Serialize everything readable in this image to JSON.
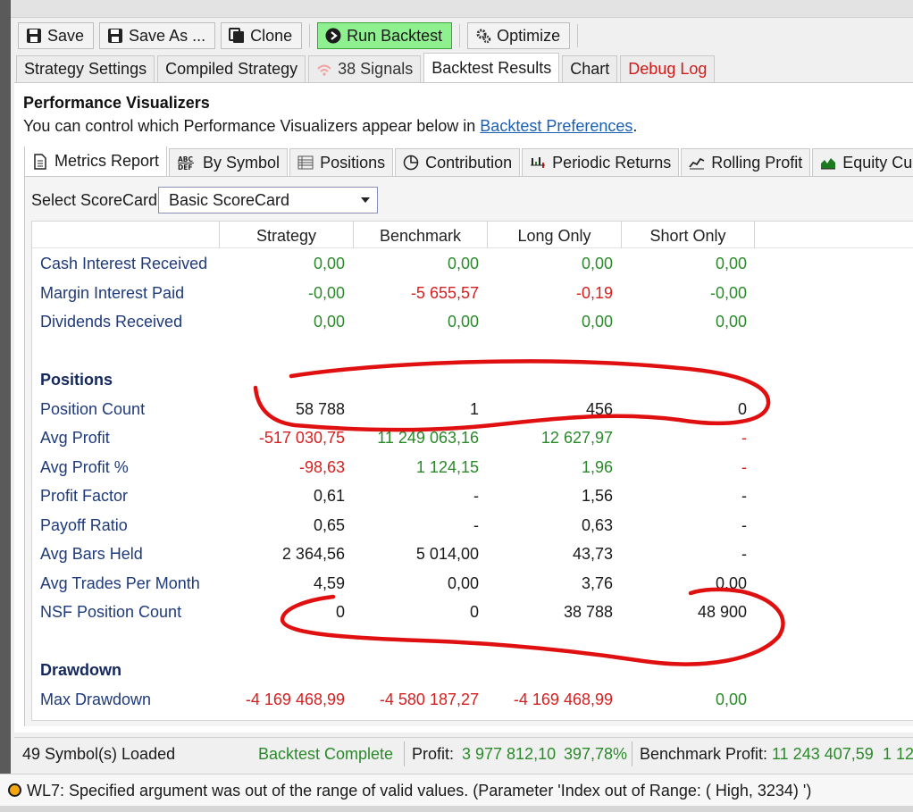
{
  "toolbar": {
    "save_label": "Save",
    "save_as_label": "Save As ...",
    "clone_label": "Clone",
    "run_backtest_label": "Run Backtest",
    "optimize_label": "Optimize"
  },
  "main_tabs": {
    "strategy_settings": "Strategy Settings",
    "compiled_strategy": "Compiled Strategy",
    "signals": "38 Signals",
    "backtest_results": "Backtest Results",
    "chart": "Chart",
    "debug_log": "Debug Log"
  },
  "visualizers": {
    "title": "Performance Visualizers",
    "desc_prefix": "You can control which Performance Visualizers appear below in ",
    "desc_link": "Backtest Preferences",
    "desc_suffix": "."
  },
  "viz_tabs": {
    "metrics_report": "Metrics Report",
    "by_symbol": "By Symbol",
    "positions": "Positions",
    "contribution": "Contribution",
    "periodic_returns": "Periodic Returns",
    "rolling_profit": "Rolling Profit",
    "equity_curve": "Equity Cu"
  },
  "scorecard": {
    "label": "Select ScoreCard:",
    "selected": "Basic ScoreCard"
  },
  "columns": [
    "Strategy",
    "Benchmark",
    "Long Only",
    "Short Only"
  ],
  "rows": [
    {
      "label": "Cash Interest Received",
      "values": [
        "0,00",
        "0,00",
        "0,00",
        "0,00"
      ],
      "colors": [
        "green",
        "green",
        "green",
        "green"
      ]
    },
    {
      "label": "Margin Interest Paid",
      "values": [
        "-0,00",
        "-5 655,57",
        "-0,19",
        "-0,00"
      ],
      "colors": [
        "green",
        "red",
        "red",
        "green"
      ]
    },
    {
      "label": "Dividends Received",
      "values": [
        "0,00",
        "0,00",
        "0,00",
        "0,00"
      ],
      "colors": [
        "green",
        "green",
        "green",
        "green"
      ]
    },
    {
      "section": "Positions"
    },
    {
      "label": "Position Count",
      "values": [
        "58 788",
        "1",
        "456",
        "0"
      ],
      "colors": [
        "black",
        "black",
        "black",
        "black"
      ]
    },
    {
      "label": "Avg Profit",
      "values": [
        "-517 030,75",
        "11 249 063,16",
        "12 627,97",
        "-"
      ],
      "colors": [
        "red",
        "green",
        "green",
        "red"
      ]
    },
    {
      "label": "Avg Profit %",
      "values": [
        "-98,63",
        "1 124,15",
        "1,96",
        "-"
      ],
      "colors": [
        "red",
        "green",
        "green",
        "red"
      ]
    },
    {
      "label": "Profit Factor",
      "values": [
        "0,61",
        "-",
        "1,56",
        "-"
      ],
      "colors": [
        "black",
        "black",
        "black",
        "black"
      ]
    },
    {
      "label": "Payoff Ratio",
      "values": [
        "0,65",
        "-",
        "0,63",
        "-"
      ],
      "colors": [
        "black",
        "black",
        "black",
        "black"
      ]
    },
    {
      "label": "Avg Bars Held",
      "values": [
        "2 364,56",
        "5 014,00",
        "43,73",
        "-"
      ],
      "colors": [
        "black",
        "black",
        "black",
        "black"
      ]
    },
    {
      "label": "Avg Trades Per Month",
      "values": [
        "4,59",
        "0,00",
        "3,76",
        "0,00"
      ],
      "colors": [
        "black",
        "black",
        "black",
        "black"
      ]
    },
    {
      "label": "NSF Position Count",
      "values": [
        "0",
        "0",
        "38 788",
        "48 900"
      ],
      "colors": [
        "black",
        "black",
        "black",
        "black"
      ]
    },
    {
      "section": "Drawdown"
    },
    {
      "label": "Max Drawdown",
      "values": [
        "-4 169 468,99",
        "-4 580 187,27",
        "-4 169 468,99",
        "0,00"
      ],
      "colors": [
        "red",
        "red",
        "red",
        "green"
      ]
    }
  ],
  "status": {
    "symbols_loaded": "49 Symbol(s) Loaded",
    "backtest_state": "Backtest Complete",
    "profit_label": "Profit:",
    "profit_value": "3 977 812,10",
    "profit_pct": "397,78%",
    "benchmark_label": "Benchmark Profit:",
    "benchmark_value": "11 243 407,59",
    "benchmark_pct": "1 12"
  },
  "message": {
    "text": "WL7: Specified argument was out of the range of valid values. (Parameter 'Index out of Range: ( High, 3234) ')"
  },
  "colors": {
    "positive": "#2a8a2a",
    "negative": "#d62020",
    "label_blue": "#1f3a7a",
    "run_button": "#8ef08e",
    "annotation_red": "#e01010"
  }
}
